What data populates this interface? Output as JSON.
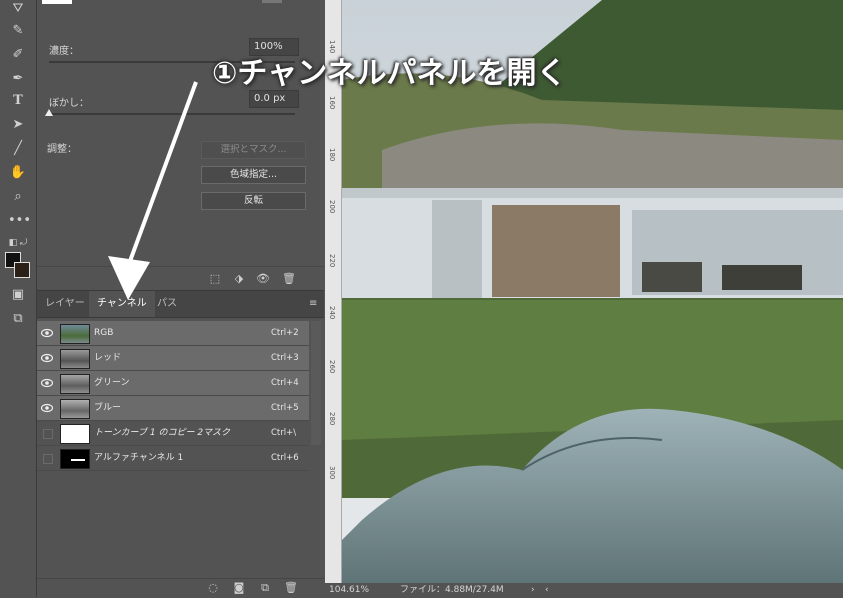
{
  "properties": {
    "density_label": "濃度：",
    "density_value": "100%",
    "feather_label": "ぼかし：",
    "feather_value": "0.0 px",
    "adjust_label": "調整：",
    "select_mask_button": "選択とマスク...",
    "color_range_button": "色域指定...",
    "invert_button": "反転"
  },
  "tabs": [
    "レイヤー",
    "チャンネル",
    "パス"
  ],
  "channels": [
    {
      "name": "RGB",
      "shortcut": "Ctrl+2"
    },
    {
      "name": "レッド",
      "shortcut": "Ctrl+3"
    },
    {
      "name": "グリーン",
      "shortcut": "Ctrl+4"
    },
    {
      "name": "ブルー",
      "shortcut": "Ctrl+5"
    },
    {
      "name": "トーンカーブ 1 のコピー 2マスク",
      "shortcut": "Ctrl+\\"
    },
    {
      "name": "アルファチャンネル 1",
      "shortcut": "Ctrl+6"
    }
  ],
  "ruler_labels": [
    "140",
    "160",
    "180",
    "200",
    "220",
    "240",
    "260",
    "280",
    "300"
  ],
  "status": {
    "zoom": "104.61%",
    "file_info": "ファイル：4.88M/27.4M"
  },
  "callout": {
    "text": "①チャンネルパネルを開く"
  },
  "icons": {
    "tools": [
      "brush-icon",
      "healing-icon",
      "pen-icon",
      "text-icon",
      "path-select-icon",
      "line-icon",
      "hand-icon",
      "zoom-icon",
      "more-icon"
    ]
  }
}
